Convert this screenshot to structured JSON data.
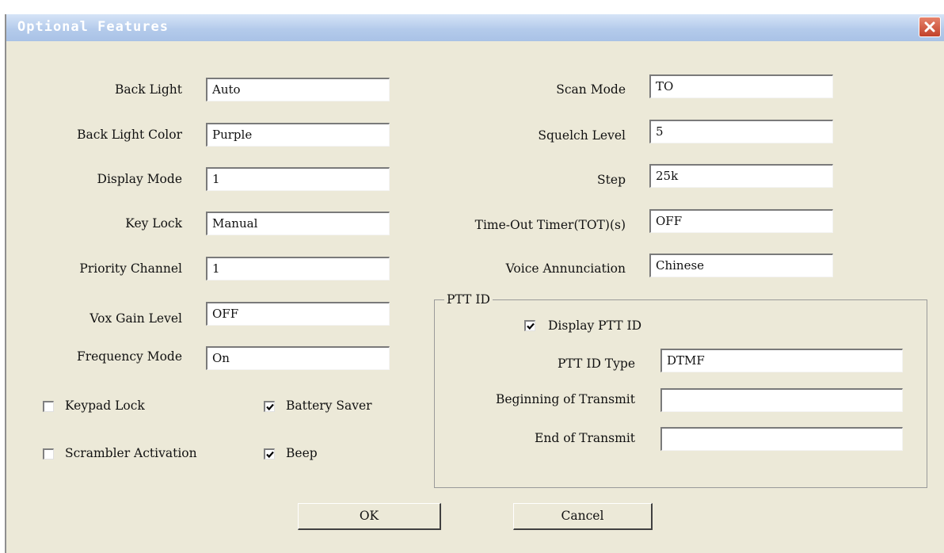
{
  "window": {
    "title": "Optional Features"
  },
  "left": {
    "back_light": {
      "label": "Back Light",
      "value": "Auto"
    },
    "back_light_color": {
      "label": "Back Light Color",
      "value": "Purple"
    },
    "display_mode": {
      "label": "Display Mode",
      "value": "1"
    },
    "key_lock": {
      "label": "Key Lock",
      "value": "Manual"
    },
    "priority_channel": {
      "label": "Priority Channel",
      "value": "1"
    },
    "vox_gain_level": {
      "label": "Vox Gain Level",
      "value": "OFF"
    },
    "frequency_mode": {
      "label": "Frequency Mode",
      "value": "On"
    }
  },
  "checkboxes": {
    "keypad_lock": {
      "label": "Keypad Lock",
      "checked": false
    },
    "battery_saver": {
      "label": "Battery Saver",
      "checked": true
    },
    "scrambler_activation": {
      "label": "Scrambler Activation",
      "checked": false
    },
    "beep": {
      "label": "Beep",
      "checked": true
    }
  },
  "right": {
    "scan_mode": {
      "label": "Scan Mode",
      "value": "TO"
    },
    "squelch_level": {
      "label": "Squelch Level",
      "value": "5"
    },
    "step": {
      "label": "Step",
      "value": "25k"
    },
    "tot": {
      "label": "Time-Out Timer(TOT)(s)",
      "value": "OFF"
    },
    "voice_annunciation": {
      "label": "Voice Annunciation",
      "value": "Chinese"
    }
  },
  "ptt": {
    "group_label": "PTT ID",
    "display_ptt_id": {
      "label": "Display PTT ID",
      "checked": true
    },
    "ptt_id_type": {
      "label": "PTT ID Type",
      "value": "DTMF"
    },
    "beginning_of_transmit": {
      "label": "Beginning of Transmit",
      "value": ""
    },
    "end_of_transmit": {
      "label": "End of Transmit",
      "value": ""
    }
  },
  "buttons": {
    "ok": "OK",
    "cancel": "Cancel"
  },
  "icons": {
    "close": "close-icon",
    "check": "checkmark-icon"
  },
  "colors": {
    "dialog_bg": "#ece9d8",
    "title_bar": "#b4cbeb",
    "close_button": "#c2412a"
  }
}
